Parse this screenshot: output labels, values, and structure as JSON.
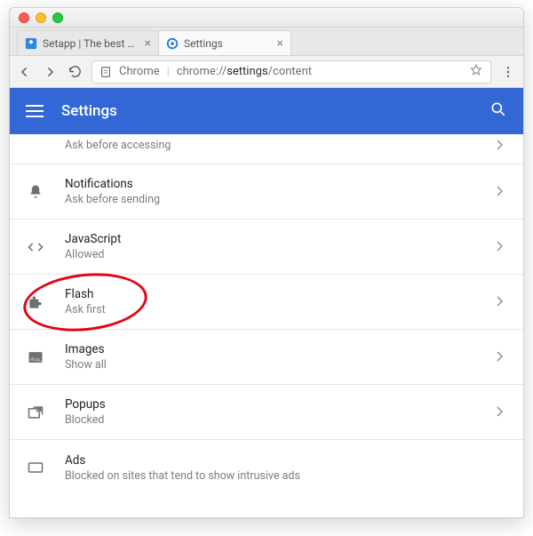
{
  "window": {
    "tabs": [
      {
        "label": "Setapp | The best apps",
        "icon": "setapp"
      },
      {
        "label": "Settings",
        "icon": "gear"
      }
    ]
  },
  "toolbar": {
    "url_scheme_label": "Chrome",
    "url_host": "chrome://",
    "url_strong": "settings",
    "url_rest": "/content"
  },
  "header": {
    "title": "Settings"
  },
  "rows": [
    {
      "key": "location",
      "title": "",
      "sub": "Ask before accessing",
      "icon": "location"
    },
    {
      "key": "notifications",
      "title": "Notifications",
      "sub": "Ask before sending",
      "icon": "bell"
    },
    {
      "key": "javascript",
      "title": "JavaScript",
      "sub": "Allowed",
      "icon": "code"
    },
    {
      "key": "flash",
      "title": "Flash",
      "sub": "Ask first",
      "icon": "puzzle"
    },
    {
      "key": "images",
      "title": "Images",
      "sub": "Show all",
      "icon": "image"
    },
    {
      "key": "popups",
      "title": "Popups",
      "sub": "Blocked",
      "icon": "popup"
    },
    {
      "key": "ads",
      "title": "Ads",
      "sub": "Blocked on sites that tend to show intrusive ads",
      "icon": "ads"
    }
  ],
  "annotation": {
    "target_row": "flash"
  }
}
